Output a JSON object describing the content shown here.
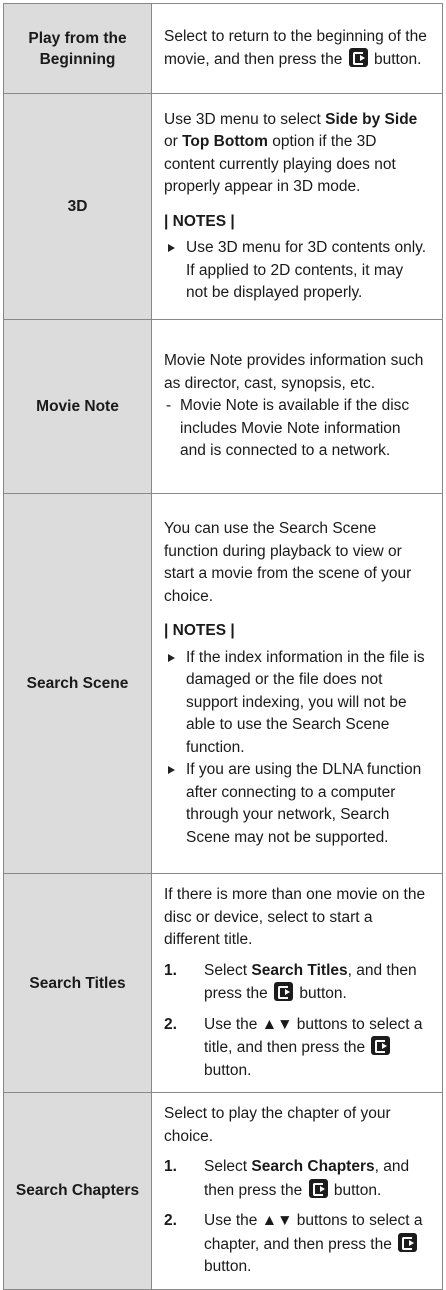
{
  "rows": {
    "play": {
      "label": "Play from the Beginning",
      "desc_a": "Select to return to the beginning of the movie, and then press the",
      "desc_b": "button."
    },
    "three_d": {
      "label": "3D",
      "desc_a": "Use 3D menu to select",
      "opt1": "Side by Side",
      "or": "or",
      "opt2": "Top Bottom",
      "desc_b": "option if the 3D content currently playing does not properly appear in 3D mode.",
      "notes_heading": "| NOTES |",
      "notes": [
        "Use 3D menu for 3D contents only. If applied to 2D contents, it may not be displayed properly."
      ]
    },
    "movie_note": {
      "label": "Movie Note",
      "desc": "Movie Note provides information such as director, cast, synopsis, etc.",
      "note": "Movie Note is available if the disc includes Movie Note information and is connected to a network."
    },
    "search_scene": {
      "label": "Search Scene",
      "desc": "You can use the Search Scene function during playback to view or start a movie from the scene of your choice.",
      "notes_heading": "| NOTES |",
      "notes": [
        "If the index information in the file is damaged or the file does not support indexing, you will not be able to use the Search Scene function.",
        "If you are using the DLNA function after connecting to a computer through your network, Search Scene may not be supported."
      ]
    },
    "search_titles": {
      "label": "Search Titles",
      "desc": "If there is more than one movie on the disc or device, select to start a different title.",
      "steps": [
        {
          "num": "1.",
          "pre": "Select",
          "bold": "Search Titles",
          "post": ", and then press the",
          "end": "button."
        },
        {
          "num": "2.",
          "text": "Use the ▲▼ buttons to select a title, and then press the",
          "end": "button."
        }
      ]
    },
    "search_chapters": {
      "label": "Search Chapters",
      "desc": "Select to play the chapter of your choice.",
      "steps": [
        {
          "num": "1.",
          "pre": "Select",
          "bold": "Search Chapters",
          "post": ", and then press the",
          "end": "button."
        },
        {
          "num": "2.",
          "text": "Use the ▲▼ buttons to select a chapter, and then press the",
          "end": "button."
        }
      ]
    }
  },
  "icons": {
    "enter": "enter-button-icon"
  }
}
